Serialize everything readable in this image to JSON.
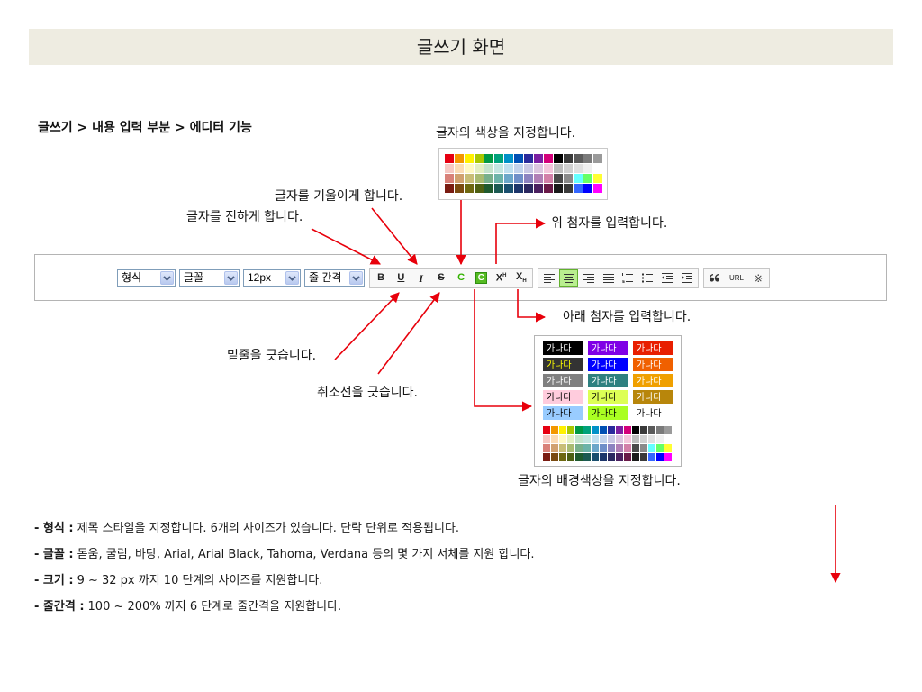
{
  "title": "글쓰기 화면",
  "breadcrumb": "글쓰기 > 내용 입력 부분 > 에디터 기능",
  "annotations": {
    "text_color": "글자의 색상을 지정합니다.",
    "italic": "글자를 기울이게 합니다.",
    "bold": "글자를 진하게 합니다.",
    "superscript": "위 첨자를 입력합니다.",
    "subscript": "아래 첨자를 입력합니다.",
    "underline": "밑줄을 긋습니다.",
    "strike": "취소선을 긋습니다.",
    "bg_color": "글자의 배경색상을 지정합니다."
  },
  "toolbar": {
    "selects": [
      {
        "value": "형식",
        "icon": "chevron-down-icon"
      },
      {
        "value": "글꼴",
        "icon": "chevron-down-icon"
      },
      {
        "value": "12px",
        "icon": "chevron-down-icon"
      },
      {
        "value": "줄 간격",
        "icon": "chevron-down-icon"
      }
    ],
    "format_buttons": [
      {
        "label": "B",
        "icon": "bold-icon"
      },
      {
        "label": "U",
        "icon": "underline-icon"
      },
      {
        "label": "I",
        "icon": "italic-icon"
      },
      {
        "label": "S",
        "icon": "strikethrough-icon"
      },
      {
        "label": "C",
        "icon": "text-color-icon"
      },
      {
        "label": "C",
        "icon": "background-color-icon"
      },
      {
        "label": "X",
        "mark": "H",
        "icon": "superscript-icon"
      },
      {
        "label": "X",
        "mark": "H",
        "icon": "subscript-icon"
      }
    ],
    "align_buttons": [
      {
        "icon": "align-left-icon",
        "active": false
      },
      {
        "icon": "align-center-icon",
        "active": true
      },
      {
        "icon": "align-right-icon",
        "active": false
      },
      {
        "icon": "align-justify-icon",
        "active": false
      },
      {
        "icon": "ordered-list-icon",
        "active": false
      },
      {
        "icon": "unordered-list-icon",
        "active": false
      },
      {
        "icon": "outdent-icon",
        "active": false
      },
      {
        "icon": "indent-icon",
        "active": false
      }
    ],
    "insert_buttons": [
      {
        "icon": "quote-icon"
      },
      {
        "label": "URL",
        "icon": "link-icon"
      },
      {
        "label": "※",
        "icon": "special-character-icon"
      }
    ]
  },
  "text_color_palette": {
    "rows": [
      [
        "#e60012",
        "#f39800",
        "#fff100",
        "#a8c700",
        "#009944",
        "#00a27a",
        "#0091c7",
        "#0050b4",
        "#2a2a9c",
        "#7b1fa2",
        "#d4007a",
        "#000000",
        "#3a3a3a",
        "#5a5a5a",
        "#7a7a7a",
        "#9a9a9a"
      ],
      [
        "#f6c9c4",
        "#fbdcb5",
        "#fff9c4",
        "#e4efc2",
        "#c4e3cb",
        "#c4e6e0",
        "#c0e0ef",
        "#c2d3ec",
        "#c9c8e5",
        "#dcc6e0",
        "#f3c6dc",
        "#bdbdbd",
        "#d0d0d0",
        "#e0e0e0",
        "#f0f0f0",
        "#ffffff"
      ],
      [
        "#d98179",
        "#d1a16f",
        "#c9be77",
        "#a9bb72",
        "#78b08b",
        "#6cb3a8",
        "#6ca7c9",
        "#6f8fc8",
        "#8c83c0",
        "#b07fb6",
        "#d27fa8",
        "#4a4a4a",
        "#8a8a8a",
        "#66ffff",
        "#66ff66",
        "#ffff33"
      ],
      [
        "#7a1c12",
        "#7a4a10",
        "#6e6810",
        "#4e6012",
        "#1f5a2e",
        "#1c5a52",
        "#1a4f6e",
        "#1c356a",
        "#2b2860",
        "#4b2060",
        "#6a1a48",
        "#1a1a1a",
        "#3a3a3a",
        "#3366ff",
        "#0000ff",
        "#ff00ff"
      ]
    ]
  },
  "bg_color_palette": {
    "sample_text": "가나다",
    "swatches": [
      {
        "bg": "#000000",
        "fg": "#ffffff"
      },
      {
        "bg": "#7f00e6",
        "fg": "#ffffff"
      },
      {
        "bg": "#e81e00",
        "fg": "#ffffff"
      },
      {
        "bg": "#333333",
        "fg": "#ffff00"
      },
      {
        "bg": "#0000ff",
        "fg": "#ffffff"
      },
      {
        "bg": "#f06000",
        "fg": "#ffffff"
      },
      {
        "bg": "#808080",
        "fg": "#ffffff"
      },
      {
        "bg": "#2e8080",
        "fg": "#ffffff"
      },
      {
        "bg": "#f0a000",
        "fg": "#ffffff"
      },
      {
        "bg": "#ffccdd",
        "fg": "#000000"
      },
      {
        "bg": "#ddff55",
        "fg": "#000000"
      },
      {
        "bg": "#b8860b",
        "fg": "#ffffff"
      },
      {
        "bg": "#99ccff",
        "fg": "#000000"
      },
      {
        "bg": "#aaff22",
        "fg": "#000000"
      },
      {
        "bg": "#ffffff",
        "fg": "#000000"
      }
    ],
    "rows": [
      [
        "#e60012",
        "#f39800",
        "#fff100",
        "#a8c700",
        "#009944",
        "#00a27a",
        "#0091c7",
        "#0050b4",
        "#2a2a9c",
        "#7b1fa2",
        "#d4007a",
        "#000000",
        "#3a3a3a",
        "#5a5a5a",
        "#7a7a7a",
        "#9a9a9a"
      ],
      [
        "#f6c9c4",
        "#fbdcb5",
        "#fff9c4",
        "#e4efc2",
        "#c4e3cb",
        "#c4e6e0",
        "#c0e0ef",
        "#c2d3ec",
        "#c9c8e5",
        "#dcc6e0",
        "#f3c6dc",
        "#bdbdbd",
        "#d0d0d0",
        "#e0e0e0",
        "#f0f0f0",
        "#ffffff"
      ],
      [
        "#d98179",
        "#d1a16f",
        "#c9be77",
        "#a9bb72",
        "#78b08b",
        "#6cb3a8",
        "#6ca7c9",
        "#6f8fc8",
        "#8c83c0",
        "#b07fb6",
        "#d27fa8",
        "#4a4a4a",
        "#8a8a8a",
        "#66ffff",
        "#66ff66",
        "#ffff33"
      ],
      [
        "#7a1c12",
        "#7a4a10",
        "#6e6810",
        "#4e6012",
        "#1f5a2e",
        "#1c5a52",
        "#1a4f6e",
        "#1c356a",
        "#2b2860",
        "#4b2060",
        "#6a1a48",
        "#1a1a1a",
        "#3a3a3a",
        "#3366ff",
        "#0000ff",
        "#ff00ff"
      ]
    ]
  },
  "notes": [
    {
      "label": "- 형식 :",
      "text": "제목 스타일을 지정합니다. 6개의 사이즈가 있습니다. 단락 단위로 적용됩니다."
    },
    {
      "label": "- 글꼴 :",
      "text": "돋움, 굴림, 바탕, Arial, Arial Black, Tahoma, Verdana 등의 몇 가지 서체를 지원 합니다."
    },
    {
      "label": "- 크기 :",
      "text": "9 ~ 32 px 까지 10 단계의 사이즈를 지원합니다."
    },
    {
      "label": "- 줄간격 :",
      "text": "100 ~ 200% 까지 6 단계로 줄간격을 지원합니다."
    }
  ],
  "colors": {
    "annotation_arrow": "#e8000b",
    "title_band": "#eeece1",
    "active_button": "#b9ee8f",
    "text_color_button": "#33b300"
  }
}
